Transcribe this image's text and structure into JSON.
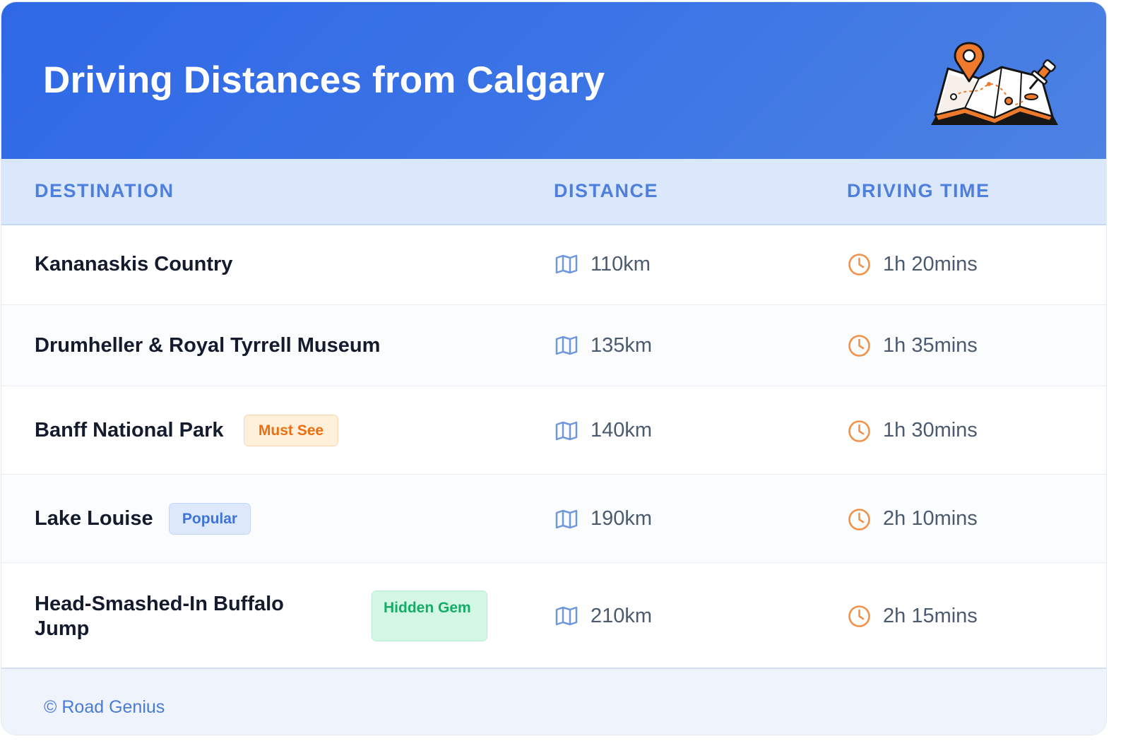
{
  "header": {
    "title": "Driving Distances from Calgary",
    "illustration_icon": "map-pin-illustration"
  },
  "table": {
    "columns": [
      "DESTINATION",
      "DISTANCE",
      "DRIVING TIME"
    ],
    "rows": [
      {
        "destination": "Kananaskis Country",
        "badge": "",
        "distance": "110km",
        "time": "1h 20mins"
      },
      {
        "destination": "Drumheller & Royal Tyrrell Museum",
        "badge": "",
        "distance": "135km",
        "time": "1h 35mins"
      },
      {
        "destination": "Banff National Park",
        "badge": "Must See",
        "distance": "140km",
        "time": "1h 30mins"
      },
      {
        "destination": "Lake Louise",
        "badge": "Popular",
        "distance": "190km",
        "time": "2h 10mins"
      },
      {
        "destination": "Head-Smashed-In Buffalo Jump",
        "badge": "Hidden Gem",
        "distance": "210km",
        "time": "2h 15mins"
      }
    ],
    "distance_icon": "map-icon",
    "time_icon": "clock-icon"
  },
  "footer": {
    "credit": "© Road Genius"
  },
  "colors": {
    "header_gradient_start": "#2f68e6",
    "header_gradient_end": "#4c82e2",
    "header_row_bg": "#dbe8fb",
    "column_header_text": "#4f7fdc",
    "icon_blue": "#6f97dc",
    "icon_orange": "#f0924a",
    "badge_orange": "#ea6f10",
    "badge_blue": "#3f73d9",
    "badge_green": "#14ad67"
  }
}
